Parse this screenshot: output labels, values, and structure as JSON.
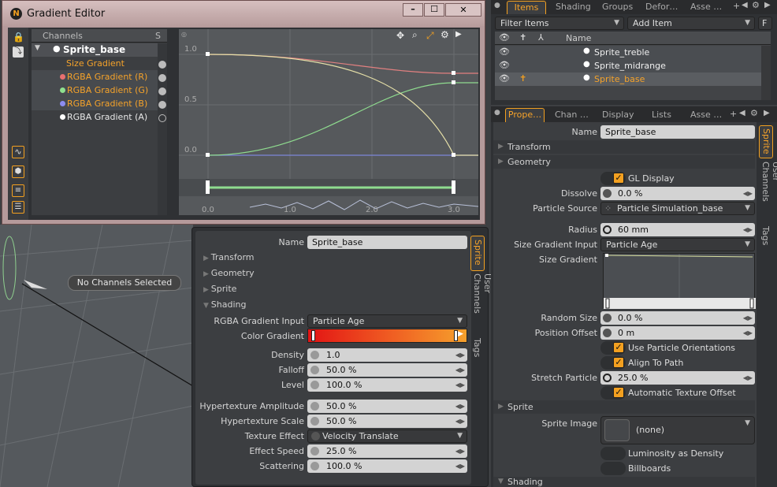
{
  "gradient_editor": {
    "title": "Gradient Editor",
    "channels_header": "Channels",
    "s_header": "S",
    "tree": [
      {
        "label": "Sprite_base"
      },
      {
        "label": "Size Gradient"
      },
      {
        "label": "RGBA Gradient (R)"
      },
      {
        "label": "RGBA Gradient (G)"
      },
      {
        "label": "RGBA Gradient (B)"
      },
      {
        "label": "RGBA Gradient (A)"
      }
    ],
    "y_labels": [
      "1.0",
      "0.5",
      "0.0"
    ],
    "x_labels": [
      "0.0",
      "1.0",
      "2.0",
      "3.0"
    ]
  },
  "viewport": {
    "no_channels": "No Channels Selected"
  },
  "shading_panel": {
    "name_label": "Name",
    "name_value": "Sprite_base",
    "sections": [
      "Transform",
      "Geometry",
      "Sprite",
      "Shading"
    ],
    "rows": [
      {
        "label": "RGBA Gradient Input",
        "value": "Particle Age"
      },
      {
        "label": "Color Gradient",
        "value": ""
      },
      {
        "label": "Density",
        "value": "1.0"
      },
      {
        "label": "Falloff",
        "value": "50.0 %"
      },
      {
        "label": "Level",
        "value": "100.0 %"
      },
      {
        "label": "Hypertexture Amplitude",
        "value": "50.0 %"
      },
      {
        "label": "Hypertexture Scale",
        "value": "50.0 %"
      },
      {
        "label": "Texture Effect",
        "value": "Velocity Translate"
      },
      {
        "label": "Effect Speed",
        "value": "25.0 %"
      },
      {
        "label": "Scattering",
        "value": "100.0 %"
      }
    ],
    "vtabs": [
      "Sprite",
      "User Channels",
      "Tags"
    ]
  },
  "items_panel": {
    "tabs": [
      "Items",
      "Shading",
      "Groups",
      "Defor…",
      "Asse …"
    ],
    "filter": "Filter Items",
    "add_item": "Add Item",
    "f_btn": "F",
    "name_header": "Name",
    "items": [
      {
        "label": "Sprite_treble"
      },
      {
        "label": "Sprite_midrange"
      },
      {
        "label": "Sprite_base"
      }
    ]
  },
  "properties_panel": {
    "tabs": [
      "Prope…",
      "Chan …",
      "Display",
      "Lists",
      "Asse …"
    ],
    "name_label": "Name",
    "name_value": "Sprite_base",
    "transform": "Transform",
    "geometry": "Geometry",
    "gl_display": "GL Display",
    "dissolve_label": "Dissolve",
    "dissolve": "0.0 %",
    "particle_source_label": "Particle Source",
    "particle_source": "Particle Simulation_base",
    "radius_label": "Radius",
    "radius": "60 mm",
    "size_grad_input_label": "Size Gradient Input",
    "size_grad_input": "Particle Age",
    "size_gradient_label": "Size Gradient",
    "random_size_label": "Random Size",
    "random_size": "0.0 %",
    "position_offset_label": "Position Offset",
    "position_offset": "0 m",
    "use_orient": "Use Particle Orientations",
    "align_path": "Align To Path",
    "stretch_label": "Stretch Particle",
    "stretch": "25.0 %",
    "auto_tex": "Automatic Texture Offset",
    "sprite_section": "Sprite",
    "sprite_image_label": "Sprite Image",
    "sprite_image": "(none)",
    "lum_density": "Luminosity as Density",
    "billboards": "Billboards",
    "shading_section": "Shading",
    "vtabs": [
      "Sprite",
      "User Channels",
      "Tags"
    ]
  },
  "colors": {
    "accent": "#f3a020",
    "title_bar": "#c9a6a6",
    "orange_text": "#f6a32a"
  }
}
